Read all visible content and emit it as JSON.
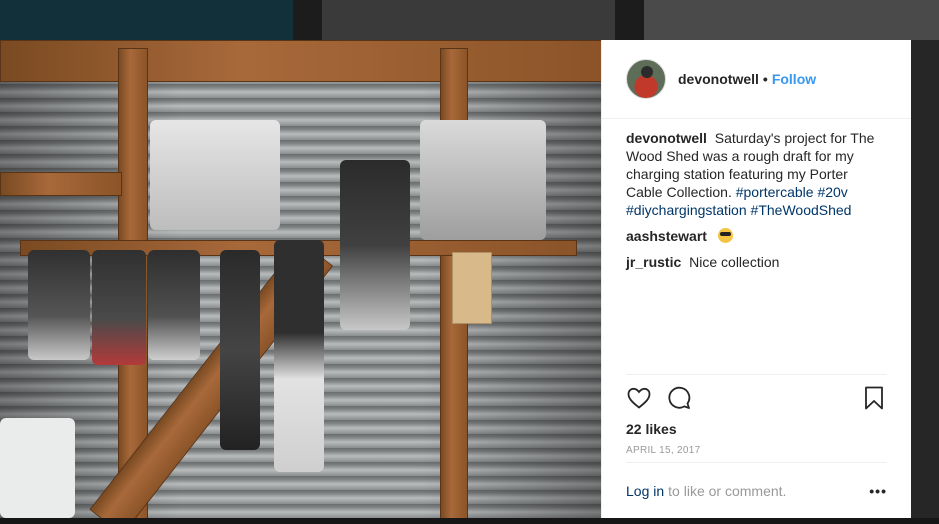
{
  "post": {
    "author": "devonotwell",
    "separator": "•",
    "follow_label": "Follow",
    "caption_text": "Saturday's project for The Wood Shed was a rough draft for my charging station featuring my Porter Cable Collection.",
    "hashtags": [
      "#portercable",
      "#20v",
      "#diychargingstation",
      "#TheWoodShed"
    ],
    "comments": [
      {
        "user": "aashstewart",
        "text": "",
        "emoji": "sunglasses-face"
      },
      {
        "user": "jr_rustic",
        "text": "Nice collection"
      }
    ],
    "likes": "22 likes",
    "date": "APRIL 15, 2017",
    "login_link": "Log in",
    "login_rest": "to like or comment.",
    "more_label": "•••"
  },
  "icons": {
    "like": "heart-outline",
    "comment": "speech-bubble-outline",
    "save": "bookmark-outline"
  },
  "colors": {
    "accent": "#3897f0",
    "hashtag": "#003569",
    "text": "#262626",
    "muted": "#999999"
  }
}
